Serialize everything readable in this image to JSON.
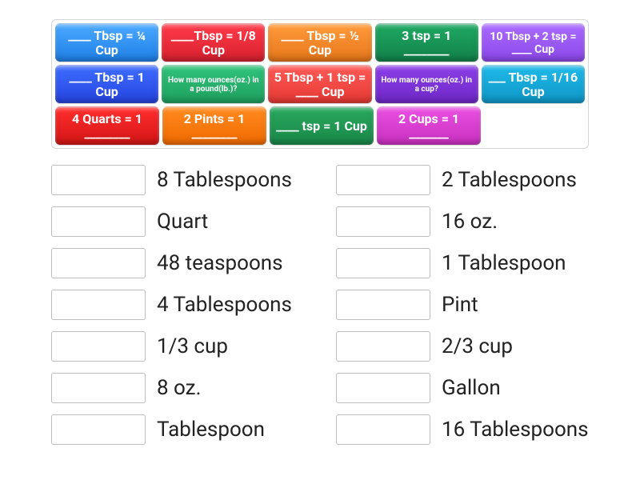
{
  "tiles": {
    "r0": [
      "____ Tbsp = ¼ Cup",
      "____Tbsp = 1/8 Cup",
      "____ Tbsp = ½ Cup",
      "3 tsp = 1 ________",
      "10 Tbsp + 2 tsp = ____ Cup"
    ],
    "r1": [
      "____ Tbsp = 1 Cup",
      "How many ounces(oz.) in a pound(lb.)?",
      "5 Tbsp + 1 tsp = ____ Cup",
      "How many ounces(oz.) in a cup?",
      "___ Tbsp = 1/16 Cup"
    ],
    "r2": [
      "4 Quarts = 1 ________",
      "2 Pints = 1 ________",
      "____ tsp = 1 Cup",
      "2 Cups = 1 _______"
    ]
  },
  "answers_left": [
    "8 Tablespoons",
    "Quart",
    "48 teaspoons",
    "4 Tablespoons",
    "1/3 cup",
    "8 oz.",
    "Tablespoon"
  ],
  "answers_right": [
    "2 Tablespoons",
    "16 oz.",
    "1 Tablespoon",
    "Pint",
    "2/3 cup",
    "Gallon",
    "16 Tablespoons"
  ]
}
